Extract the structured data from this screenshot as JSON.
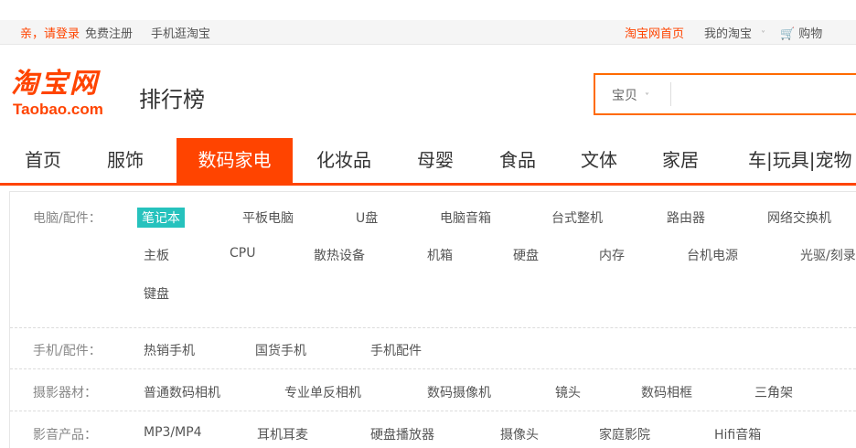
{
  "topbar": {
    "greeting": "亲，请登录",
    "register": "免费注册",
    "mobile": "手机逛淘宝",
    "home": "淘宝网首页",
    "my_taobao": "我的淘宝",
    "caret": "˅",
    "cart": "购物"
  },
  "header": {
    "logo_cn": "淘宝网",
    "logo_en": "Taobao.com",
    "title": "排行榜",
    "search": {
      "scope": "宝贝",
      "scope_caret": "˅"
    }
  },
  "nav": {
    "tabs": [
      "首页",
      "服饰",
      "数码家电",
      "化妆品",
      "母婴",
      "食品",
      "文体",
      "家居",
      "车|玩具|宠物"
    ],
    "active_index": 2
  },
  "categories": {
    "computers": {
      "label": "电脑/配件：",
      "items": [
        "笔记本",
        "平板电脑",
        "U盘",
        "电脑音箱",
        "台式整机",
        "路由器",
        "网络交换机",
        "主板",
        "CPU",
        "散热设备",
        "机箱",
        "硬盘",
        "内存",
        "台机电源",
        "光驱/刻录",
        "键盘"
      ],
      "selected": "笔记本"
    },
    "phones": {
      "label": "手机/配件：",
      "items": [
        "热销手机",
        "国货手机",
        "手机配件"
      ]
    },
    "cameras": {
      "label": "摄影器材：",
      "items": [
        "普通数码相机",
        "专业单反相机",
        "数码摄像机",
        "镜头",
        "数码相框",
        "三角架"
      ]
    },
    "audio": {
      "label": "影音产品：",
      "items": [
        "MP3/MP4",
        "耳机耳麦",
        "硬盘播放器",
        "摄像头",
        "家庭影院",
        "Hifi音箱"
      ]
    }
  },
  "colors": {
    "brand": "#ff4400",
    "selected_tag": "#26c2bd"
  }
}
